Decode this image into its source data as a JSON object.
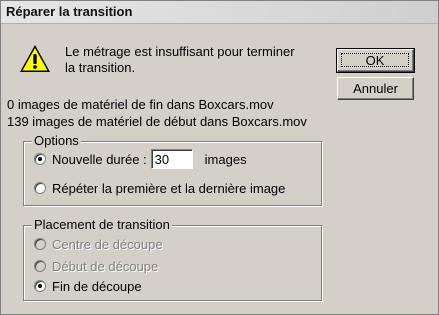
{
  "window": {
    "title": "Réparer la transition"
  },
  "message": {
    "line1": "Le métrage est insuffisant pour terminer",
    "line2": "la transition."
  },
  "info": {
    "end_material": "0 images de matériel de fin dans Boxcars.mov",
    "start_material": "139 images de matériel de début dans Boxcars.mov"
  },
  "buttons": {
    "ok": "OK",
    "cancel": "Annuler"
  },
  "options": {
    "legend": "Options",
    "new_duration_label": "Nouvelle durée :",
    "new_duration_value": "30",
    "new_duration_unit": "images",
    "repeat_label": "Répéter la première et la dernière image",
    "selected": "new_duration"
  },
  "placement": {
    "legend": "Placement de transition",
    "center": "Centre de découpe",
    "start": "Début de découpe",
    "end": "Fin de découpe",
    "selected": "end"
  }
}
